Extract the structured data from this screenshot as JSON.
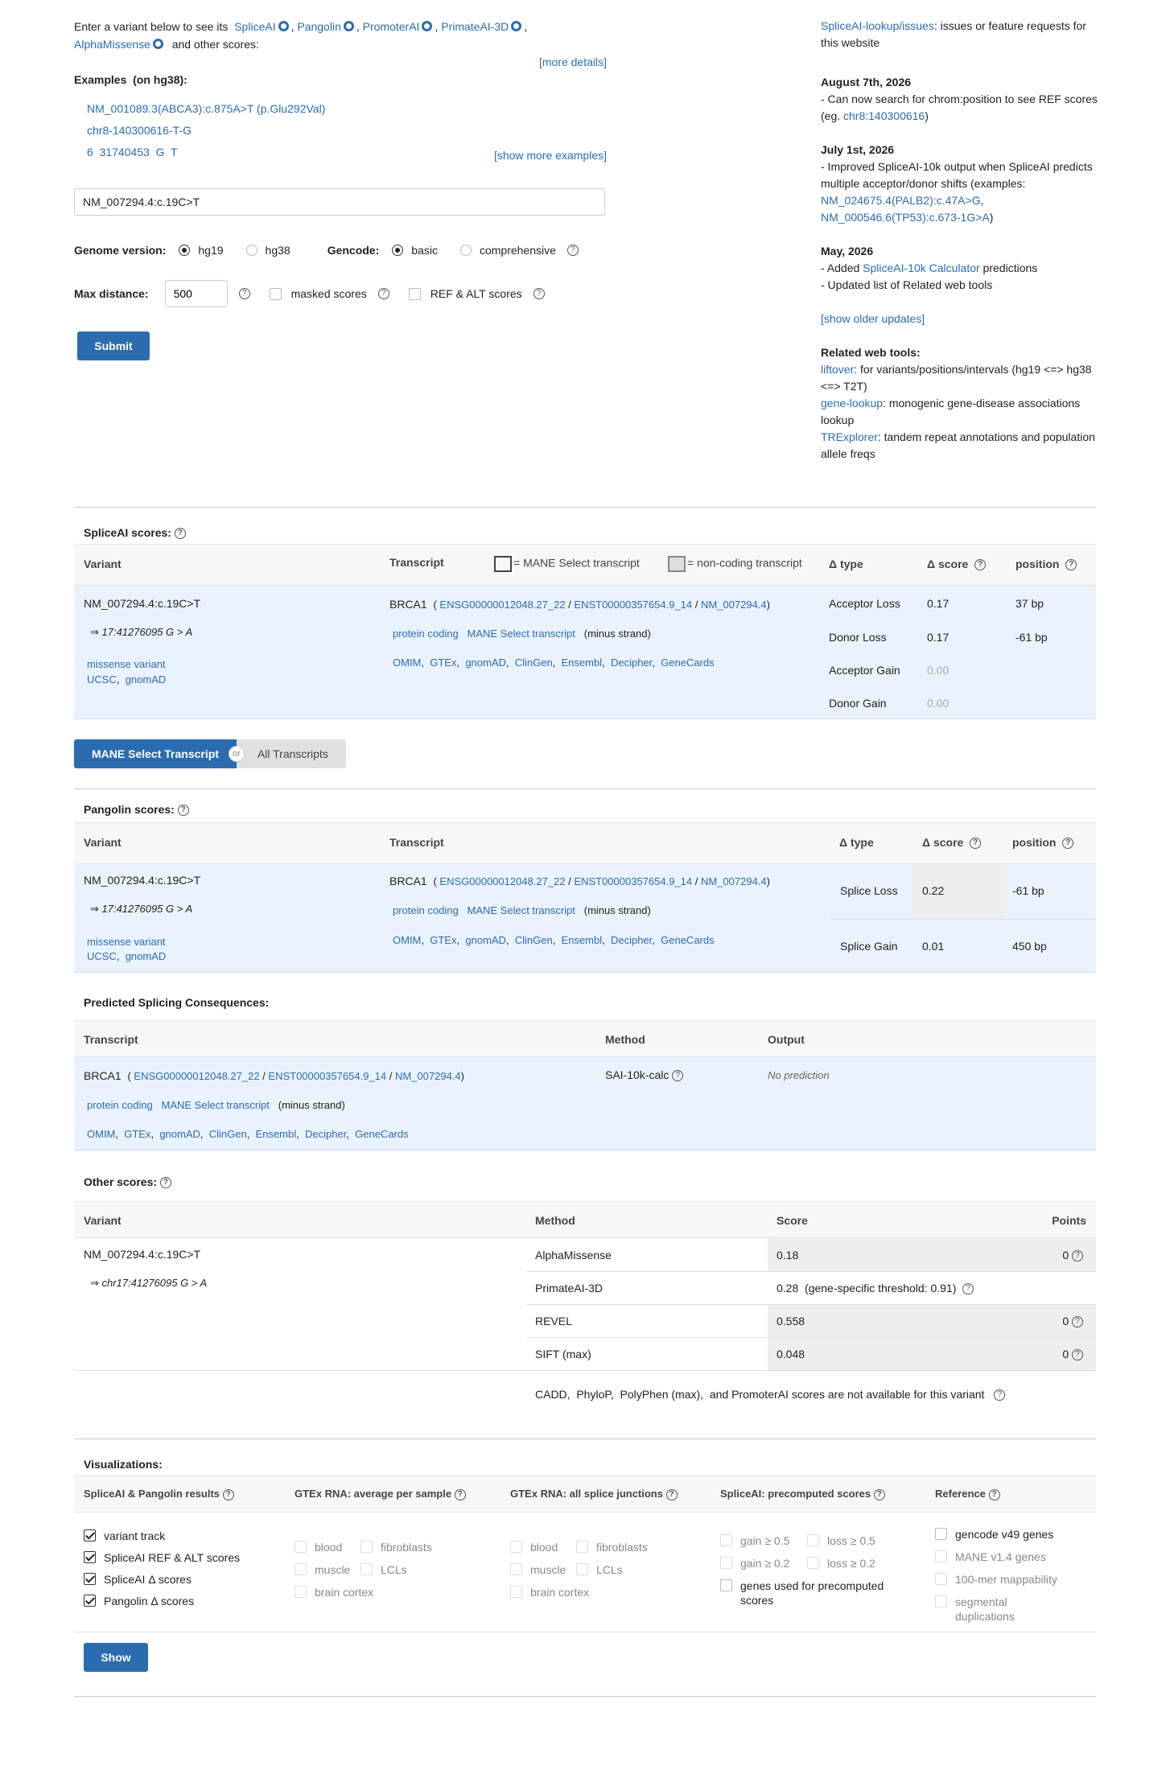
{
  "intro": {
    "prefix": "Enter a variant below to see its",
    "tools": [
      "SpliceAI",
      "Pangolin",
      "PromoterAI",
      "PrimateAI-3D",
      "AlphaMissense"
    ],
    "suffix": "and other scores:",
    "more_details": "[more details]"
  },
  "examples": {
    "title": "Examples",
    "subtitle": "(on hg38):",
    "items": [
      "NM_001089.3(ABCA3):c.875A>T (p.Glu292Val)",
      "chr8-140300616-T-G",
      "6  31740453  G  T"
    ],
    "show_more": "[show more examples]"
  },
  "form": {
    "variant_value": "NM_007294.4:c.19C>T",
    "genome_label": "Genome version:",
    "genome_options": [
      "hg19",
      "hg38"
    ],
    "gencode_label": "Gencode:",
    "gencode_options": [
      "basic",
      "comprehensive"
    ],
    "maxdist_label": "Max distance:",
    "maxdist_value": "500",
    "masked_label": "masked scores",
    "refalt_label": "REF & ALT scores",
    "submit": "Submit"
  },
  "news": {
    "issues_link": "SpliceAI-lookup/issues",
    "issues_text": ": issues or feature requests for this website",
    "entries": [
      {
        "date": "August 7th, 2026",
        "line1": "- Can now search for chrom:position to see REF scores (eg. ",
        "link": "chr8:140300616",
        "line2": ")"
      },
      {
        "date": "July 1st, 2026",
        "line1": "- Improved SpliceAI-10k output when SpliceAI predicts multiple acceptor/donor shifts (examples: ",
        "link": "NM_024675.4(PALB2):c.47A>G",
        "link2": "NM_000546.6(TP53):c.673-1G>A",
        "line2": ")"
      },
      {
        "date": "May, 2026",
        "line1": "- Added ",
        "link": "SpliceAI-10k Calculator",
        "line2": " predictions",
        "line3": "- Updated list of Related web tools"
      }
    ],
    "older": "[show older updates]",
    "related_title": "Related web tools:",
    "related": [
      {
        "name": "liftover",
        "desc": ": for variants/positions/intervals (hg19 <=> hg38 <=> T2T)"
      },
      {
        "name": "gene-lookup",
        "desc": ": monogenic gene-disease associations lookup"
      },
      {
        "name": "TRExplorer",
        "desc": ": tandem repeat annotations and population allele freqs"
      }
    ]
  },
  "shared": {
    "variant": "NM_007294.4:c.19C>T",
    "coord": "⇒ 17:41276095 G > A",
    "consequence": "missense variant",
    "ucsc": "UCSC",
    "gnomad": "gnomAD",
    "gene": "BRCA1",
    "ensg": "ENSG00000012048.27_22",
    "enst": "ENST00000357654.9_14",
    "nm": "NM_007294.4",
    "biotype": "protein coding",
    "mane": "MANE Select transcript",
    "strand": "(minus strand)",
    "links": [
      "OMIM",
      "GTEx",
      "gnomAD",
      "ClinGen",
      "Ensembl",
      "Decipher",
      "GeneCards"
    ]
  },
  "spliceai": {
    "title": "SpliceAI scores:",
    "headers": {
      "variant": "Variant",
      "transcript": "Transcript",
      "legend_mane": "= MANE Select transcript",
      "legend_nc": "= non-coding transcript",
      "dtype": "Δ type",
      "dscore": "Δ score",
      "position": "position"
    },
    "rows": [
      {
        "type": "Acceptor Loss",
        "score": "0.17",
        "pos": "37 bp"
      },
      {
        "type": "Donor Loss",
        "score": "0.17",
        "pos": "-61 bp"
      },
      {
        "type": "Acceptor Gain",
        "score": "0.00",
        "pos": ""
      },
      {
        "type": "Donor Gain",
        "score": "0.00",
        "pos": ""
      }
    ]
  },
  "toggle": {
    "on": "MANE Select Transcript",
    "or": "or",
    "off": "All Transcripts"
  },
  "pangolin": {
    "title": "Pangolin scores:",
    "rows": [
      {
        "type": "Splice Loss",
        "score": "0.22",
        "pos": "-61 bp"
      },
      {
        "type": "Splice Gain",
        "score": "0.01",
        "pos": "450 bp"
      }
    ]
  },
  "consequences": {
    "title": "Predicted Splicing Consequences:",
    "headers": {
      "transcript": "Transcript",
      "method": "Method",
      "output": "Output"
    },
    "method": "SAI-10k-calc",
    "output": "No prediction"
  },
  "other": {
    "title": "Other scores:",
    "headers": {
      "variant": "Variant",
      "method": "Method",
      "score": "Score",
      "points": "Points"
    },
    "coord": "⇒ chr17:41276095 G > A",
    "rows": [
      {
        "method": "AlphaMissense",
        "score": "0.18",
        "points": "0"
      },
      {
        "method": "PrimateAI-3D",
        "score": "0.28  (gene-specific threshold: 0.91)",
        "points": ""
      },
      {
        "method": "REVEL",
        "score": "0.558",
        "points": "0"
      },
      {
        "method": "SIFT (max)",
        "score": "0.048",
        "points": "0"
      }
    ],
    "note": "CADD,  PhyloP,  PolyPhen (max),  and PromoterAI scores are not available for this variant"
  },
  "vis": {
    "title": "Visualizations:",
    "col1": {
      "title": "SpliceAI & Pangolin results",
      "items": [
        "variant track",
        "SpliceAI REF & ALT scores",
        "SpliceAI Δ  scores",
        "Pangolin Δ  scores"
      ]
    },
    "col2": {
      "title": "GTEx RNA: average per sample",
      "items": [
        "blood",
        "fibroblasts",
        "muscle",
        "LCLs",
        "brain cortex"
      ]
    },
    "col3": {
      "title": "GTEx RNA: all splice junctions",
      "items": [
        "blood",
        "fibroblasts",
        "muscle",
        "LCLs",
        "brain cortex"
      ]
    },
    "col4": {
      "title": "SpliceAI: precomputed scores",
      "items": [
        "gain ≥ 0.5",
        "loss ≥ 0.5",
        "gain ≥ 0.2",
        "loss ≥ 0.2",
        "genes used for precomputed scores"
      ]
    },
    "col5": {
      "title": "Reference",
      "items": [
        "gencode v49 genes",
        "MANE v1.4 genes",
        "100-mer mappability",
        "segmental duplications"
      ]
    },
    "show": "Show"
  }
}
